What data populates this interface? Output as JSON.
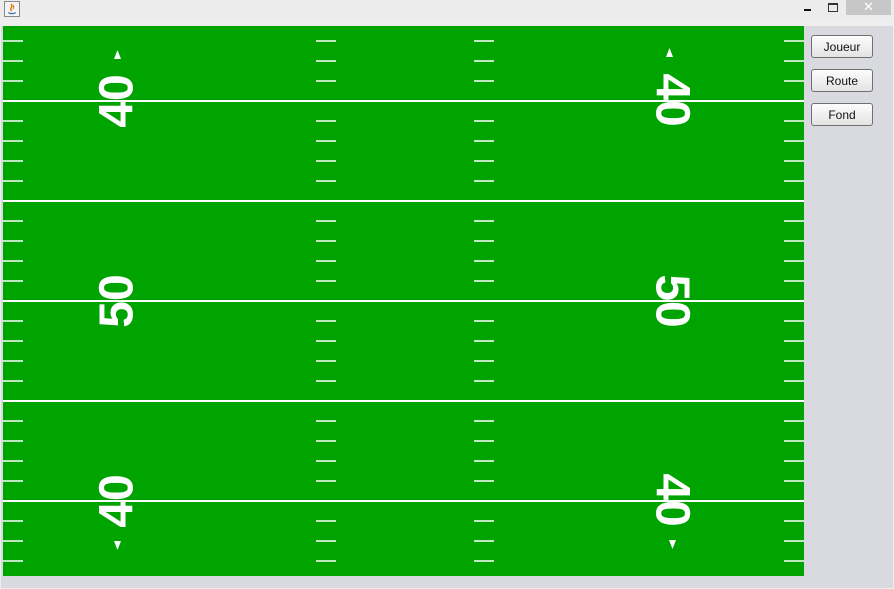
{
  "window": {
    "title": "",
    "controls": {
      "minimize": "minimize-icon",
      "maximize": "maximize-icon",
      "close": "✕"
    }
  },
  "field": {
    "colors": {
      "grass": "#00a400",
      "lines": "#ffffff"
    },
    "numbers": [
      {
        "id": "left-top",
        "text": "40"
      },
      {
        "id": "left-mid",
        "text": "50"
      },
      {
        "id": "left-bot",
        "text": "40"
      },
      {
        "id": "right-top",
        "text": "40"
      },
      {
        "id": "right-mid",
        "text": "50"
      },
      {
        "id": "right-bot",
        "text": "40"
      }
    ]
  },
  "toolbar": {
    "buttons": [
      {
        "id": "joueur",
        "label": "Joueur"
      },
      {
        "id": "route",
        "label": "Route"
      },
      {
        "id": "fond",
        "label": "Fond"
      }
    ]
  }
}
